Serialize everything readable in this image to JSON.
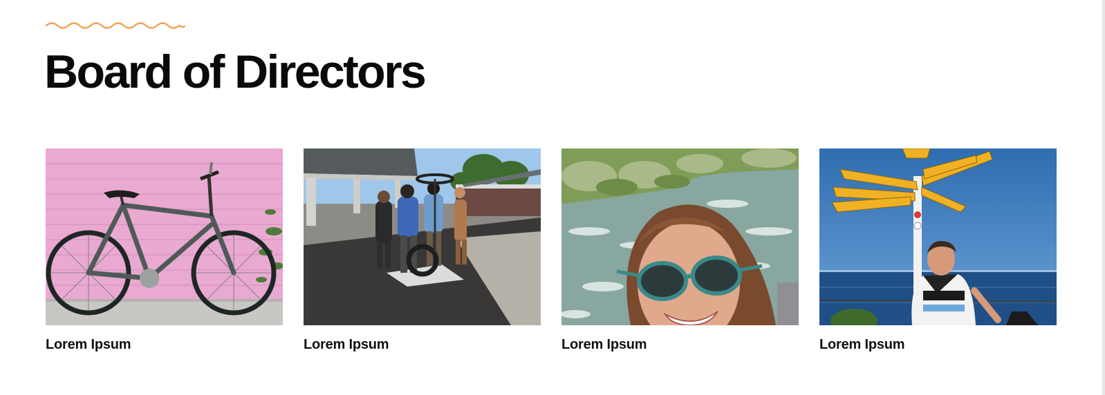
{
  "header": {
    "title": "Board of Directors",
    "accent_color": "#f2a154"
  },
  "directors": [
    {
      "name": "Lorem Ipsum",
      "photo": "bicycle against pink wall"
    },
    {
      "name": "Lorem Ipsum",
      "photo": "group repairing bicycle under solar canopy"
    },
    {
      "name": "Lorem Ipsum",
      "photo": "selfie with sunglasses by river rapids"
    },
    {
      "name": "Lorem Ipsum",
      "photo": "cyclist under signpost by the sea"
    }
  ]
}
